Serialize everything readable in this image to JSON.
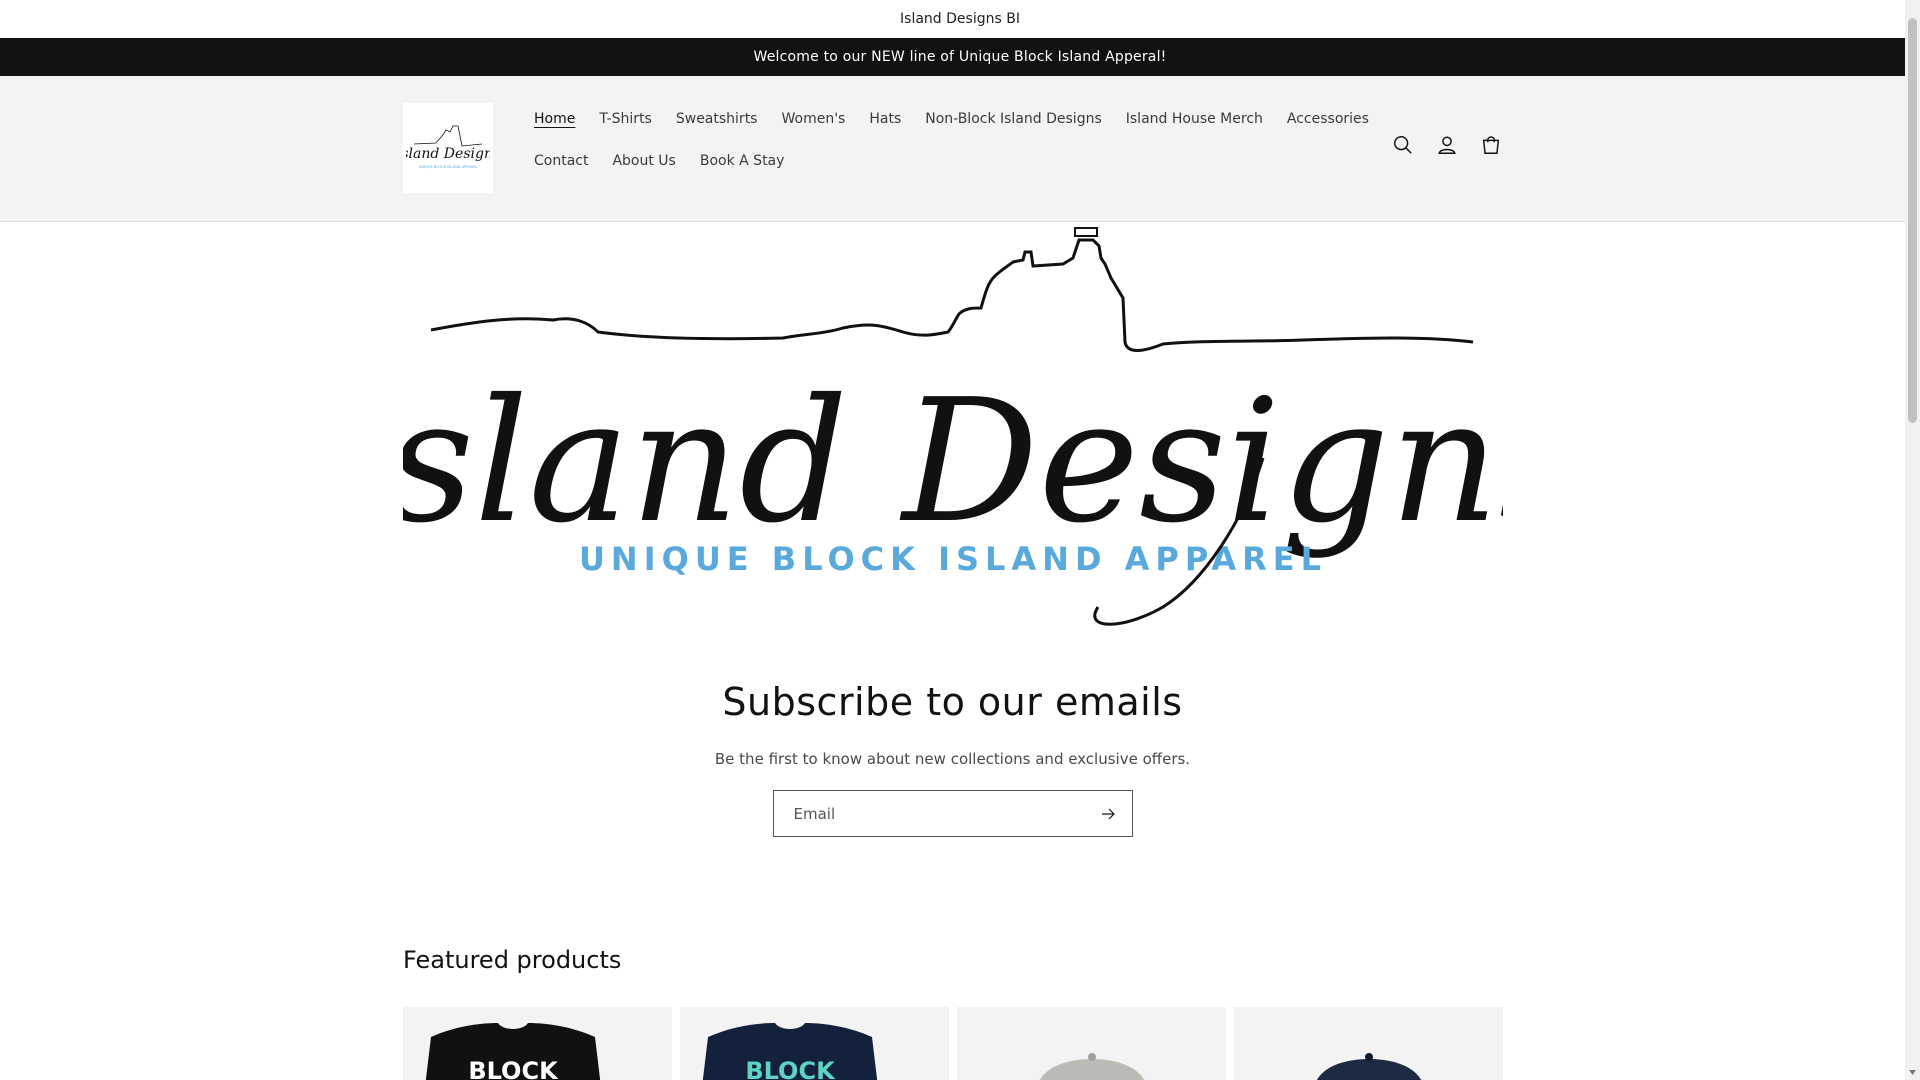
{
  "top_bar": {
    "text": "Island Designs BI"
  },
  "announcement": {
    "text": "Welcome to our NEW line of Unique Block Island Apperal!"
  },
  "logo": {
    "alt": "Island Designs",
    "tagline": "UNIQUE BLOCK ISLAND APPAREL"
  },
  "nav": {
    "row1": [
      "Home",
      "T-Shirts",
      "Sweatshirts",
      "Women's",
      "Hats",
      "Non-Block Island Designs",
      "Island House Merch",
      "Accessories"
    ],
    "row2": [
      "Contact",
      "About Us",
      "Book A Stay"
    ],
    "active": "Home"
  },
  "header_icons": [
    "search-icon",
    "account-icon",
    "cart-icon"
  ],
  "banner": {
    "title": "Island Designs",
    "subtitle": "UNIQUE BLOCK ISLAND APPAREL"
  },
  "subscribe": {
    "heading": "Subscribe to our emails",
    "text": "Be the first to know about new collections and exclusive offers.",
    "email_placeholder": "Email"
  },
  "featured": {
    "title": "Featured products",
    "products": [
      {
        "label": "BLOCK",
        "shirt_color": "#111111",
        "text_color": "#ffffff",
        "kind": "shirt"
      },
      {
        "label": "BLOCK",
        "shirt_color": "#14213d",
        "text_color": "#5ed3c3",
        "kind": "shirt"
      },
      {
        "kind": "hat",
        "hat_color": "#b9bcb4"
      },
      {
        "kind": "hat",
        "hat_color": "#1d2a44"
      }
    ]
  },
  "colors": {
    "announce_bg": "#121212",
    "header_bg": "#f3f3f3",
    "tagline_blue": "#5aa9dc"
  }
}
